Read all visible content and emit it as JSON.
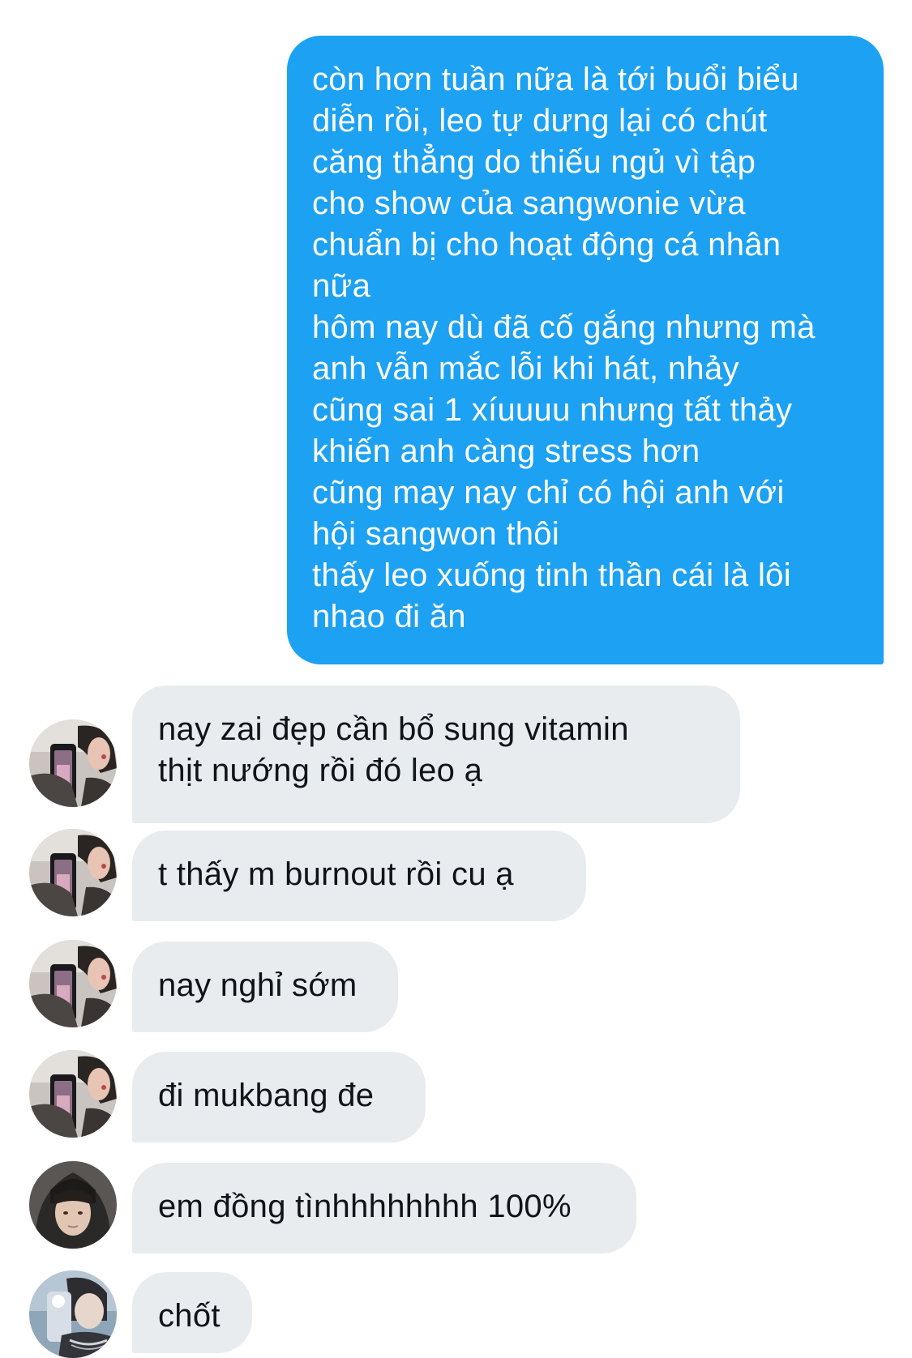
{
  "colors": {
    "outgoing_bubble": "#1da1f2",
    "outgoing_text": "#ffffff",
    "incoming_bubble": "#e8ecef",
    "incoming_text": "#0f1419",
    "background": "#ffffff"
  },
  "messages": [
    {
      "direction": "outgoing",
      "lines": [
        "còn hơn tuần nữa là tới buổi biểu",
        "diễn rồi, leo tự dưng lại có chút",
        "căng thẳng do thiếu ngủ vì tập",
        "cho show của sangwonie vừa",
        "chuẩn bị cho hoạt động cá nhân",
        "nữa",
        "hôm nay dù đã cố gắng nhưng mà",
        "anh vẫn mắc lỗi khi hát, nhảy",
        "cũng sai 1 xíuuuu nhưng tất thảy",
        "khiến anh càng stress hơn",
        "cũng may nay chỉ có hội anh với",
        "hội sangwon thôi",
        "thấy leo xuống tinh thần cái là lôi",
        "nhao đi ăn"
      ]
    },
    {
      "direction": "incoming",
      "avatar_icon": "mirror-selfie-avatar-icon",
      "lines": [
        "nay zai đẹp cần bổ sung vitamin",
        "thịt nướng rồi đó leo ạ"
      ]
    },
    {
      "direction": "incoming",
      "avatar_icon": "mirror-selfie-avatar-icon",
      "lines": [
        "t thấy m burnout rồi cu ạ"
      ]
    },
    {
      "direction": "incoming",
      "avatar_icon": "mirror-selfie-avatar-icon",
      "lines": [
        "nay nghỉ sớm"
      ]
    },
    {
      "direction": "incoming",
      "avatar_icon": "mirror-selfie-avatar-icon",
      "lines": [
        "đi mukbang đe"
      ]
    },
    {
      "direction": "incoming",
      "avatar_icon": "hooded-portrait-avatar-icon",
      "lines": [
        "em đồng tìnhhhhhhhh 100%"
      ]
    },
    {
      "direction": "incoming",
      "avatar_icon": "phone-selfie-avatar-icon",
      "lines": [
        "chốt"
      ]
    }
  ]
}
